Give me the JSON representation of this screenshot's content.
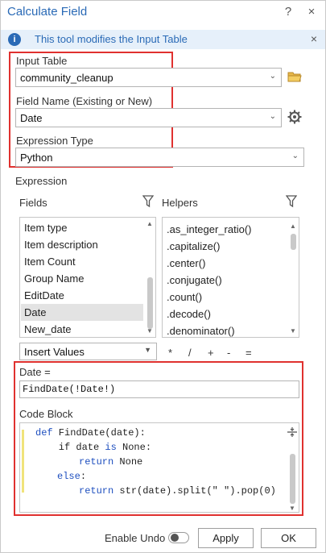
{
  "window": {
    "title": "Calculate Field",
    "help": "?",
    "close": "×"
  },
  "info": {
    "icon": "i",
    "text": "This tool modifies the Input Table",
    "close": "×"
  },
  "input_table": {
    "label": "Input Table",
    "value": "community_cleanup"
  },
  "field_name": {
    "label": "Field Name (Existing or New)",
    "value": "Date"
  },
  "expression_type": {
    "label": "Expression Type",
    "value": "Python"
  },
  "expression": {
    "label": "Expression",
    "fields_label": "Fields",
    "helpers_label": "Helpers",
    "fields": [
      "Item type",
      "Item description",
      "Item Count",
      "Group Name",
      "EditDate",
      "Date",
      "New_date"
    ],
    "selected_field": "Date",
    "helpers": [
      ".as_integer_ratio()",
      ".capitalize()",
      ".center()",
      ".conjugate()",
      ".count()",
      ".decode()",
      ".denominator()"
    ],
    "insert_values": "Insert Values",
    "operators": [
      "*",
      "/",
      "+",
      "-",
      "="
    ]
  },
  "date_expression": {
    "label": "Date =",
    "value": "FindDate(!Date!)"
  },
  "code_block": {
    "label": "Code Block",
    "lines": [
      {
        "kw": "def",
        "rest": " FindDate(date):"
      },
      {
        "pre": "    if date ",
        "kw": "is",
        "rest": " None:"
      },
      {
        "kw": "return",
        "rest": " None"
      },
      {
        "kw": "else",
        "rest": ":"
      },
      {
        "kw": "return",
        "rest": " str(date).split(\" \").pop(0)"
      }
    ]
  },
  "footer": {
    "enable_undo": "Enable Undo",
    "apply": "Apply",
    "ok": "OK"
  },
  "colors": {
    "accent": "#2a6ab6",
    "highlight": "#e0312f"
  }
}
